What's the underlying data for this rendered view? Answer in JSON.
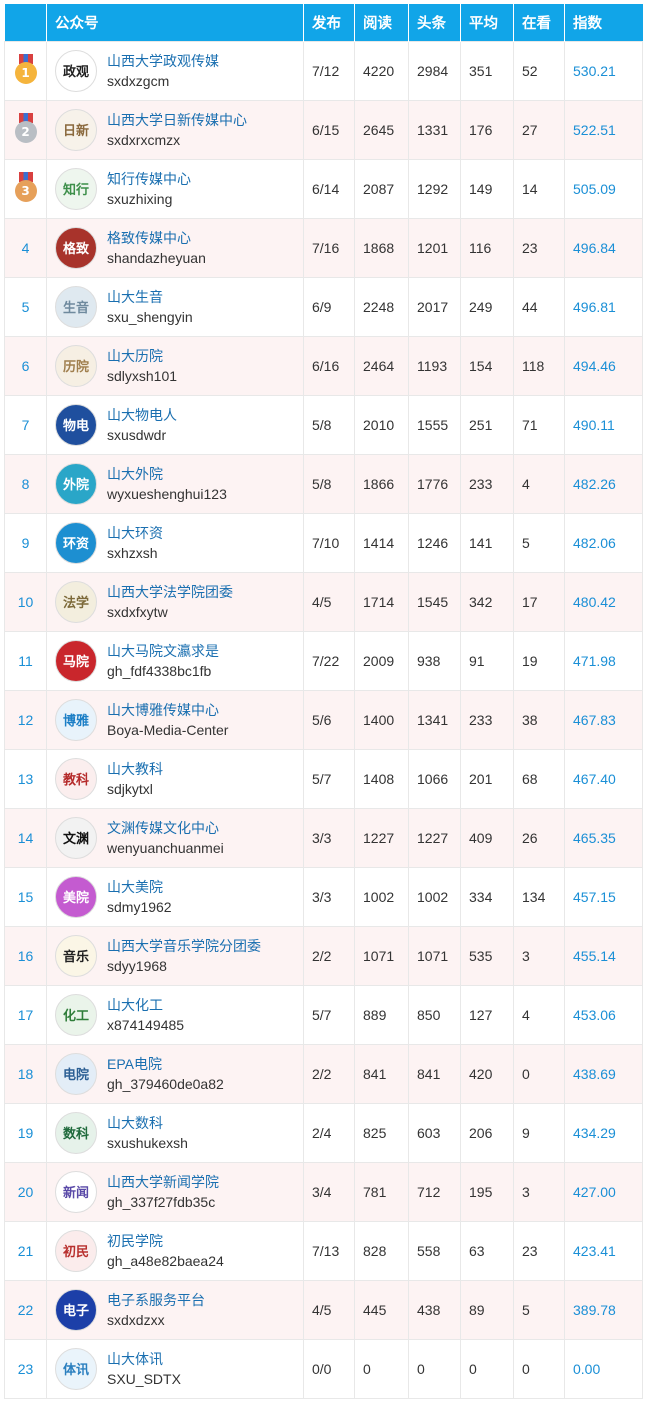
{
  "headers": {
    "account": "公众号",
    "publish": "发布",
    "read": "阅读",
    "headline": "头条",
    "average": "平均",
    "watching": "在看",
    "index": "指数"
  },
  "colors": {
    "header_bg": "#11a5e8",
    "even_row_bg": "#fdf3f3",
    "link": "#1a6fb0",
    "index_text": "#1a8fd6",
    "gold": "#f5b43c",
    "silver": "#b9bec4",
    "bronze": "#e6a05a"
  },
  "medals": [
    {
      "icon": "gold-medal-icon",
      "label": "1"
    },
    {
      "icon": "silver-medal-icon",
      "label": "2"
    },
    {
      "icon": "bronze-medal-icon",
      "label": "3"
    }
  ],
  "rows": [
    {
      "rank": "1",
      "name": "山西大学政观传媒",
      "id": "sxdxzgcm",
      "publish": "7/12",
      "read": "4220",
      "headline": "2984",
      "average": "351",
      "watching": "52",
      "index": "530.21",
      "avatar_bg": "#ffffff",
      "avatar_fg": "#222222",
      "avatar_glyph": "政观"
    },
    {
      "rank": "2",
      "name": "山西大学日新传媒中心",
      "id": "sxdxrxcmzx",
      "publish": "6/15",
      "read": "2645",
      "headline": "1331",
      "average": "176",
      "watching": "27",
      "index": "522.51",
      "avatar_bg": "#f7f2ea",
      "avatar_fg": "#8b6a3e",
      "avatar_glyph": "日新"
    },
    {
      "rank": "3",
      "name": "知行传媒中心",
      "id": "sxuzhixing",
      "publish": "6/14",
      "read": "2087",
      "headline": "1292",
      "average": "149",
      "watching": "14",
      "index": "505.09",
      "avatar_bg": "#eef6ee",
      "avatar_fg": "#3d8f4a",
      "avatar_glyph": "知行"
    },
    {
      "rank": "4",
      "name": "格致传媒中心",
      "id": "shandazheyuan",
      "publish": "7/16",
      "read": "1868",
      "headline": "1201",
      "average": "116",
      "watching": "23",
      "index": "496.84",
      "avatar_bg": "#a8332b",
      "avatar_fg": "#ffffff",
      "avatar_glyph": "格致"
    },
    {
      "rank": "5",
      "name": "山大生音",
      "id": "sxu_shengyin",
      "publish": "6/9",
      "read": "2248",
      "headline": "2017",
      "average": "249",
      "watching": "44",
      "index": "496.81",
      "avatar_bg": "#dfe9f0",
      "avatar_fg": "#6f8a9e",
      "avatar_glyph": "生音"
    },
    {
      "rank": "6",
      "name": "山大历院",
      "id": "sdlyxsh101",
      "publish": "6/16",
      "read": "2464",
      "headline": "1193",
      "average": "154",
      "watching": "118",
      "index": "494.46",
      "avatar_bg": "#f6efe3",
      "avatar_fg": "#a07f4e",
      "avatar_glyph": "历院"
    },
    {
      "rank": "7",
      "name": "山大物电人",
      "id": "sxusdwdr",
      "publish": "5/8",
      "read": "2010",
      "headline": "1555",
      "average": "251",
      "watching": "71",
      "index": "490.11",
      "avatar_bg": "#1f4f9e",
      "avatar_fg": "#ffffff",
      "avatar_glyph": "物电"
    },
    {
      "rank": "8",
      "name": "山大外院",
      "id": "wyxueshenghui123",
      "publish": "5/8",
      "read": "1866",
      "headline": "1776",
      "average": "233",
      "watching": "4",
      "index": "482.26",
      "avatar_bg": "#2aa6c8",
      "avatar_fg": "#ffffff",
      "avatar_glyph": "外院"
    },
    {
      "rank": "9",
      "name": "山大环资",
      "id": "sxhzxsh",
      "publish": "7/10",
      "read": "1414",
      "headline": "1246",
      "average": "141",
      "watching": "5",
      "index": "482.06",
      "avatar_bg": "#1d8fd1",
      "avatar_fg": "#ffffff",
      "avatar_glyph": "环资"
    },
    {
      "rank": "10",
      "name": "山西大学法学院团委",
      "id": "sxdxfxytw",
      "publish": "4/5",
      "read": "1714",
      "headline": "1545",
      "average": "342",
      "watching": "17",
      "index": "480.42",
      "avatar_bg": "#f3eede",
      "avatar_fg": "#7d6a3a",
      "avatar_glyph": "法学"
    },
    {
      "rank": "11",
      "name": "山大马院文瀛求是",
      "id": "gh_fdf4338bc1fb",
      "publish": "7/22",
      "read": "2009",
      "headline": "938",
      "average": "91",
      "watching": "19",
      "index": "471.98",
      "avatar_bg": "#c9262c",
      "avatar_fg": "#ffffff",
      "avatar_glyph": "马院"
    },
    {
      "rank": "12",
      "name": "山大博雅传媒中心",
      "id": "Boya-Media-Center",
      "publish": "5/6",
      "read": "1400",
      "headline": "1341",
      "average": "233",
      "watching": "38",
      "index": "467.83",
      "avatar_bg": "#e8f3fb",
      "avatar_fg": "#1c7fc6",
      "avatar_glyph": "博雅"
    },
    {
      "rank": "13",
      "name": "山大教科",
      "id": "sdjkytxl",
      "publish": "5/7",
      "read": "1408",
      "headline": "1066",
      "average": "201",
      "watching": "68",
      "index": "467.40",
      "avatar_bg": "#fbeeee",
      "avatar_fg": "#b52b2b",
      "avatar_glyph": "教科"
    },
    {
      "rank": "14",
      "name": "文渊传媒文化中心",
      "id": "wenyuanchuanmei",
      "publish": "3/3",
      "read": "1227",
      "headline": "1227",
      "average": "409",
      "watching": "26",
      "index": "465.35",
      "avatar_bg": "#f2f2f2",
      "avatar_fg": "#111111",
      "avatar_glyph": "文渊"
    },
    {
      "rank": "15",
      "name": "山大美院",
      "id": "sdmy1962",
      "publish": "3/3",
      "read": "1002",
      "headline": "1002",
      "average": "334",
      "watching": "134",
      "index": "457.15",
      "avatar_bg": "#c45bd0",
      "avatar_fg": "#ffffff",
      "avatar_glyph": "美院"
    },
    {
      "rank": "16",
      "name": "山西大学音乐学院分团委",
      "id": "sdyy1968",
      "publish": "2/2",
      "read": "1071",
      "headline": "1071",
      "average": "535",
      "watching": "3",
      "index": "455.14",
      "avatar_bg": "#fbf6e6",
      "avatar_fg": "#222222",
      "avatar_glyph": "音乐"
    },
    {
      "rank": "17",
      "name": "山大化工",
      "id": "x874149485",
      "publish": "5/7",
      "read": "889",
      "headline": "850",
      "average": "127",
      "watching": "4",
      "index": "453.06",
      "avatar_bg": "#eaf4ea",
      "avatar_fg": "#2f7d3a",
      "avatar_glyph": "化工"
    },
    {
      "rank": "18",
      "name": "EPA电院",
      "id": "gh_379460de0a82",
      "publish": "2/2",
      "read": "841",
      "headline": "841",
      "average": "420",
      "watching": "0",
      "index": "438.69",
      "avatar_bg": "#e3edf7",
      "avatar_fg": "#2c5f94",
      "avatar_glyph": "电院"
    },
    {
      "rank": "19",
      "name": "山大数科",
      "id": "sxushukexsh",
      "publish": "2/4",
      "read": "825",
      "headline": "603",
      "average": "206",
      "watching": "9",
      "index": "434.29",
      "avatar_bg": "#e6f2ea",
      "avatar_fg": "#1f6a3c",
      "avatar_glyph": "数科"
    },
    {
      "rank": "20",
      "name": "山西大学新闻学院",
      "id": "gh_337f27fdb35c",
      "publish": "3/4",
      "read": "781",
      "headline": "712",
      "average": "195",
      "watching": "3",
      "index": "427.00",
      "avatar_bg": "#ffffff",
      "avatar_fg": "#5a4aa8",
      "avatar_glyph": "新闻"
    },
    {
      "rank": "21",
      "name": "初民学院",
      "id": "gh_a48e82baea24",
      "publish": "7/13",
      "read": "828",
      "headline": "558",
      "average": "63",
      "watching": "23",
      "index": "423.41",
      "avatar_bg": "#fbecec",
      "avatar_fg": "#b8302e",
      "avatar_glyph": "初民"
    },
    {
      "rank": "22",
      "name": "电子系服务平台",
      "id": "sxdxdzxx",
      "publish": "4/5",
      "read": "445",
      "headline": "438",
      "average": "89",
      "watching": "5",
      "index": "389.78",
      "avatar_bg": "#1c3fa8",
      "avatar_fg": "#ffffff",
      "avatar_glyph": "电子"
    },
    {
      "rank": "23",
      "name": "山大体讯",
      "id": "SXU_SDTX",
      "publish": "0/0",
      "read": "0",
      "headline": "0",
      "average": "0",
      "watching": "0",
      "index": "0.00",
      "avatar_bg": "#eaf4fb",
      "avatar_fg": "#2a7fbf",
      "avatar_glyph": "体讯"
    }
  ]
}
